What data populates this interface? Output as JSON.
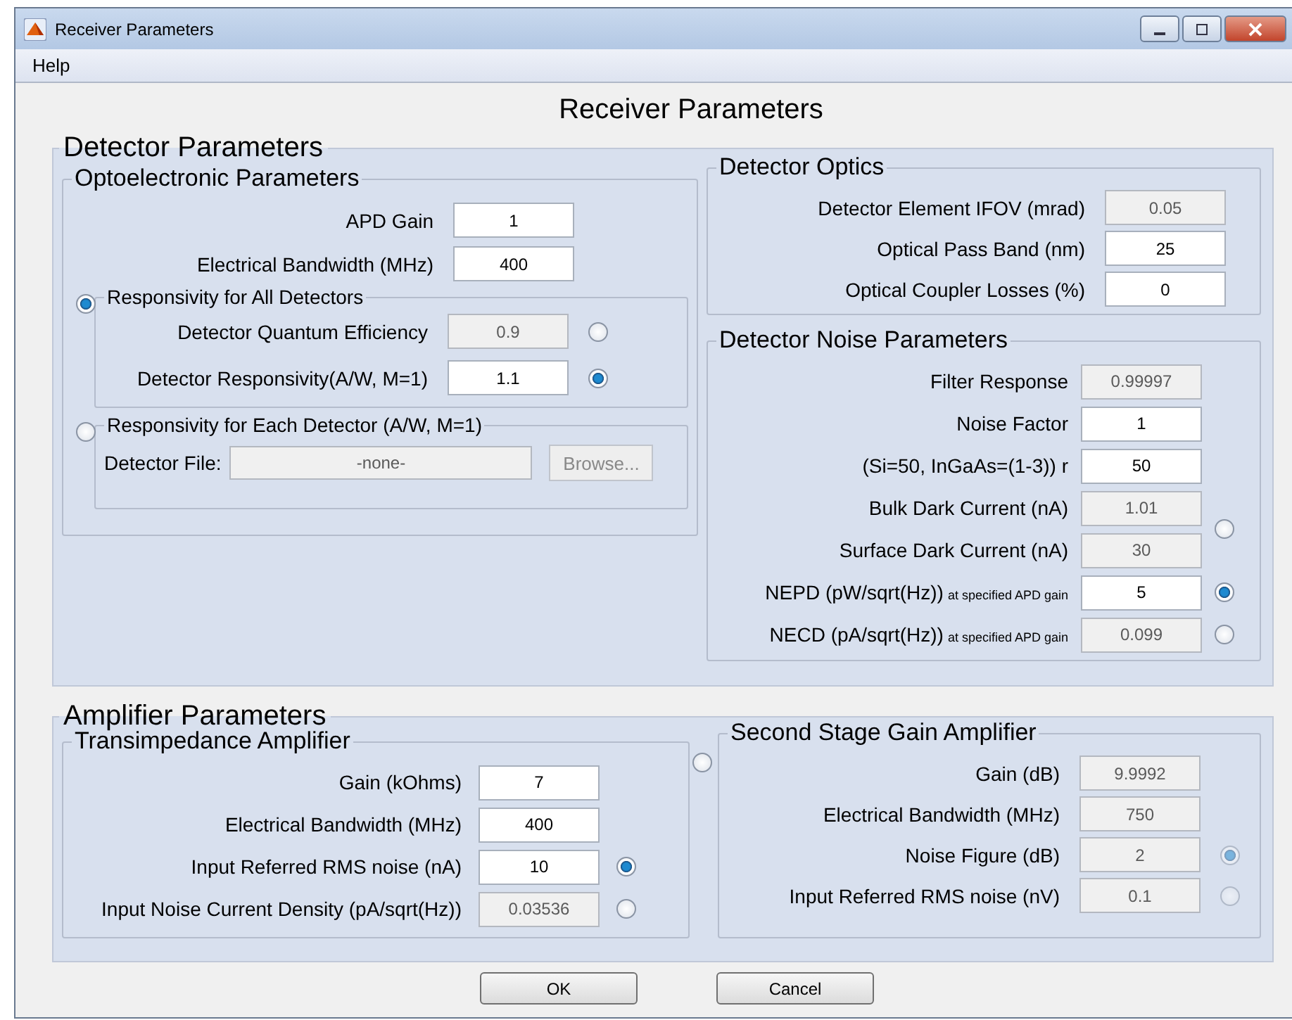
{
  "window": {
    "title": "Receiver Parameters"
  },
  "menu": [
    "Help"
  ],
  "heading": "Receiver Parameters",
  "detector": {
    "title": "Detector Parameters",
    "opto": {
      "title": "Optoelectronic Parameters",
      "rows": [
        {
          "label": "APD Gain",
          "value": "1",
          "disabled": false
        },
        {
          "label": "Electrical Bandwidth (MHz)",
          "value": "400",
          "disabled": false
        }
      ],
      "all": {
        "title": "Responsivity for All Detectors",
        "selected": true,
        "rows": [
          {
            "label": "Detector Quantum Efficiency",
            "value": "0.9",
            "disabled": true,
            "radio": {
              "selected": false,
              "disabled": false
            }
          },
          {
            "label": "Detector Responsivity(A/W, M=1)",
            "value": "1.1",
            "disabled": false,
            "radio": {
              "selected": true,
              "disabled": false
            }
          }
        ]
      },
      "each": {
        "title": "Responsivity for Each Detector (A/W, M=1)",
        "selected": false,
        "file_label": "Detector File:",
        "file_value": "-none-",
        "browse": "Browse..."
      }
    },
    "optics": {
      "title": "Detector Optics",
      "rows": [
        {
          "label": "Detector Element IFOV (mrad)",
          "value": "0.05",
          "disabled": true
        },
        {
          "label": "Optical Pass Band (nm)",
          "value": "25",
          "disabled": false
        },
        {
          "label": "Optical Coupler Losses (%)",
          "value": "0",
          "disabled": false
        }
      ]
    },
    "noise": {
      "title": "Detector Noise Parameters",
      "rows": [
        {
          "label": "Filter Response",
          "value": "0.99997",
          "disabled": true
        },
        {
          "label": "Noise Factor",
          "value": "1",
          "disabled": false
        },
        {
          "label": "(Si=50, InGaAs=(1-3))  r",
          "value": "50",
          "disabled": false
        },
        {
          "label": "Bulk Dark Current (nA)",
          "value": "1.01",
          "disabled": true
        },
        {
          "label": "Surface Dark Current (nA)",
          "value": "30",
          "disabled": true,
          "radio": {
            "selected": false,
            "disabled": false
          }
        },
        {
          "label": "NEPD (pW/sqrt(Hz))",
          "note": "at specified APD gain",
          "value": "5",
          "disabled": false,
          "radio": {
            "selected": true,
            "disabled": false
          }
        },
        {
          "label": "NECD (pA/sqrt(Hz))",
          "note": "at specified APD gain",
          "value": "0.099",
          "disabled": true,
          "radio": {
            "selected": false,
            "disabled": false
          }
        }
      ]
    }
  },
  "amplifier": {
    "title": "Amplifier Parameters",
    "trans": {
      "title": "Transimpedance Amplifier",
      "rows": [
        {
          "label": "Gain (kOhms)",
          "value": "7",
          "disabled": false
        },
        {
          "label": "Electrical Bandwidth (MHz)",
          "value": "400",
          "disabled": false
        },
        {
          "label": "Input Referred RMS noise (nA)",
          "value": "10",
          "disabled": false,
          "radio": {
            "selected": true,
            "disabled": false
          }
        },
        {
          "label": "Input Noise Current Density (pA/sqrt(Hz))",
          "value": "0.03536",
          "disabled": true,
          "radio": {
            "selected": false,
            "disabled": false
          }
        }
      ]
    },
    "second": {
      "title": "Second Stage Gain Amplifier",
      "selected": false,
      "rows": [
        {
          "label": "Gain (dB)",
          "value": "9.9992",
          "disabled": true
        },
        {
          "label": "Electrical Bandwidth (MHz)",
          "value": "750",
          "disabled": true
        },
        {
          "label": "Noise Figure (dB)",
          "value": "2",
          "disabled": true,
          "radio": {
            "selected": true,
            "disabled": true
          }
        },
        {
          "label": "Input Referred RMS noise (nV)",
          "value": "0.1",
          "disabled": true,
          "radio": {
            "selected": false,
            "disabled": true
          }
        }
      ]
    }
  },
  "buttons": [
    "OK",
    "Cancel"
  ]
}
